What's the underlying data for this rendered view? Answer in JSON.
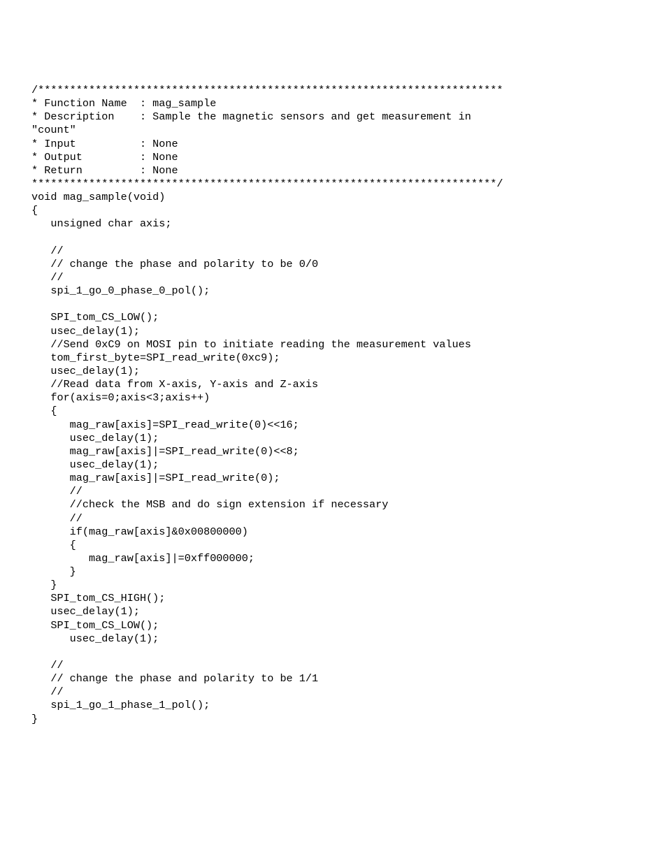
{
  "code": {
    "lines": [
      "/*************************************************************************",
      "* Function Name  : mag_sample",
      "* Description    : Sample the magnetic sensors and get measurement in",
      "\"count\"",
      "* Input          : None",
      "* Output         : None",
      "* Return         : None",
      "*************************************************************************/",
      "void mag_sample(void)",
      "{",
      "   unsigned char axis;",
      "",
      "   //",
      "   // change the phase and polarity to be 0/0",
      "   //",
      "   spi_1_go_0_phase_0_pol();",
      "",
      "   SPI_tom_CS_LOW();",
      "   usec_delay(1);",
      "   //Send 0xC9 on MOSI pin to initiate reading the measurement values",
      "   tom_first_byte=SPI_read_write(0xc9);",
      "   usec_delay(1);",
      "   //Read data from X-axis, Y-axis and Z-axis",
      "   for(axis=0;axis<3;axis++)",
      "   {",
      "      mag_raw[axis]=SPI_read_write(0)<<16;",
      "      usec_delay(1);",
      "      mag_raw[axis]|=SPI_read_write(0)<<8;",
      "      usec_delay(1);",
      "      mag_raw[axis]|=SPI_read_write(0);",
      "      //",
      "      //check the MSB and do sign extension if necessary",
      "      //",
      "      if(mag_raw[axis]&0x00800000)",
      "      {",
      "         mag_raw[axis]|=0xff000000;",
      "      }",
      "   }",
      "   SPI_tom_CS_HIGH();",
      "   usec_delay(1);",
      "   SPI_tom_CS_LOW();",
      "      usec_delay(1);",
      "",
      "   //",
      "   // change the phase and polarity to be 1/1",
      "   //",
      "   spi_1_go_1_phase_1_pol();",
      "}"
    ]
  }
}
